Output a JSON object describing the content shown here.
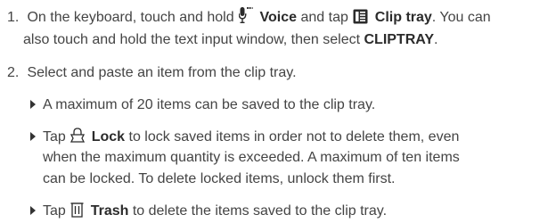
{
  "steps": [
    {
      "number": "1.",
      "pre1": "On the keyboard, touch and hold",
      "voice_label": "Voice",
      "mid1": "and tap",
      "cliptray_label": "Clip tray",
      "post1": ". You can",
      "line2_pre": "also touch and hold the text input window, then select",
      "cliptray_upper": "CLIPTRAY",
      "line2_post": "."
    },
    {
      "number": "2.",
      "text": "Select and paste an item from the clip tray."
    }
  ],
  "bullets": [
    {
      "text": "A maximum of 20 items can be saved to the clip tray."
    },
    {
      "pre": "Tap",
      "label": "Lock",
      "line1_post": "to lock saved items in order not to delete them, even",
      "line2": "when the maximum quantity is exceeded. A maximum of ten items",
      "line3": "can be locked. To delete locked items, unlock them first."
    },
    {
      "pre": "Tap",
      "label": "Trash",
      "post": "to delete the items saved to the clip tray."
    }
  ],
  "icons": [
    "microphone-icon",
    "clip-tray-icon",
    "lock-icon",
    "trash-icon"
  ]
}
